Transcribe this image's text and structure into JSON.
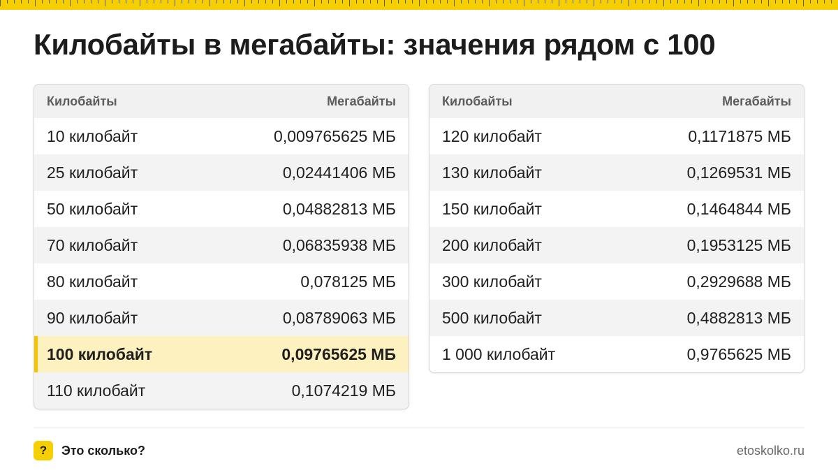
{
  "title": "Килобайты в мегабайты: значения рядом с 100",
  "tables": [
    {
      "header": {
        "left": "Килобайты",
        "right": "Мегабайты"
      },
      "rows": [
        {
          "kb": "10 килобайт",
          "mb": "0,009765625 МБ"
        },
        {
          "kb": "25 килобайт",
          "mb": "0,02441406 МБ"
        },
        {
          "kb": "50 килобайт",
          "mb": "0,04882813 МБ"
        },
        {
          "kb": "70 килобайт",
          "mb": "0,06835938 МБ"
        },
        {
          "kb": "80 килобайт",
          "mb": "0,078125 МБ"
        },
        {
          "kb": "90 килобайт",
          "mb": "0,08789063 МБ"
        },
        {
          "kb": "100 килобайт",
          "mb": "0,09765625 МБ",
          "highlighted": true
        },
        {
          "kb": "110 килобайт",
          "mb": "0,1074219 МБ"
        }
      ]
    },
    {
      "header": {
        "left": "Килобайты",
        "right": "Мегабайты"
      },
      "rows": [
        {
          "kb": "120 килобайт",
          "mb": "0,1171875 МБ"
        },
        {
          "kb": "130 килобайт",
          "mb": "0,1269531 МБ"
        },
        {
          "kb": "150 килобайт",
          "mb": "0,1464844 МБ"
        },
        {
          "kb": "200 килобайт",
          "mb": "0,1953125 МБ"
        },
        {
          "kb": "300 килобайт",
          "mb": "0,2929688 МБ"
        },
        {
          "kb": "500 килобайт",
          "mb": "0,4882813 МБ"
        },
        {
          "kb": "1 000 килобайт",
          "mb": "0,9765625 МБ"
        }
      ]
    }
  ],
  "footer": {
    "icon_glyph": "?",
    "icon": "question-icon",
    "brand": "Это сколько?",
    "site": "etoskolko.ru"
  },
  "colors": {
    "accent": "#f5cf00",
    "highlight_row": "#fdf1c0",
    "zebra": "#f3f3f3",
    "header_bg": "#f1f1f1"
  }
}
